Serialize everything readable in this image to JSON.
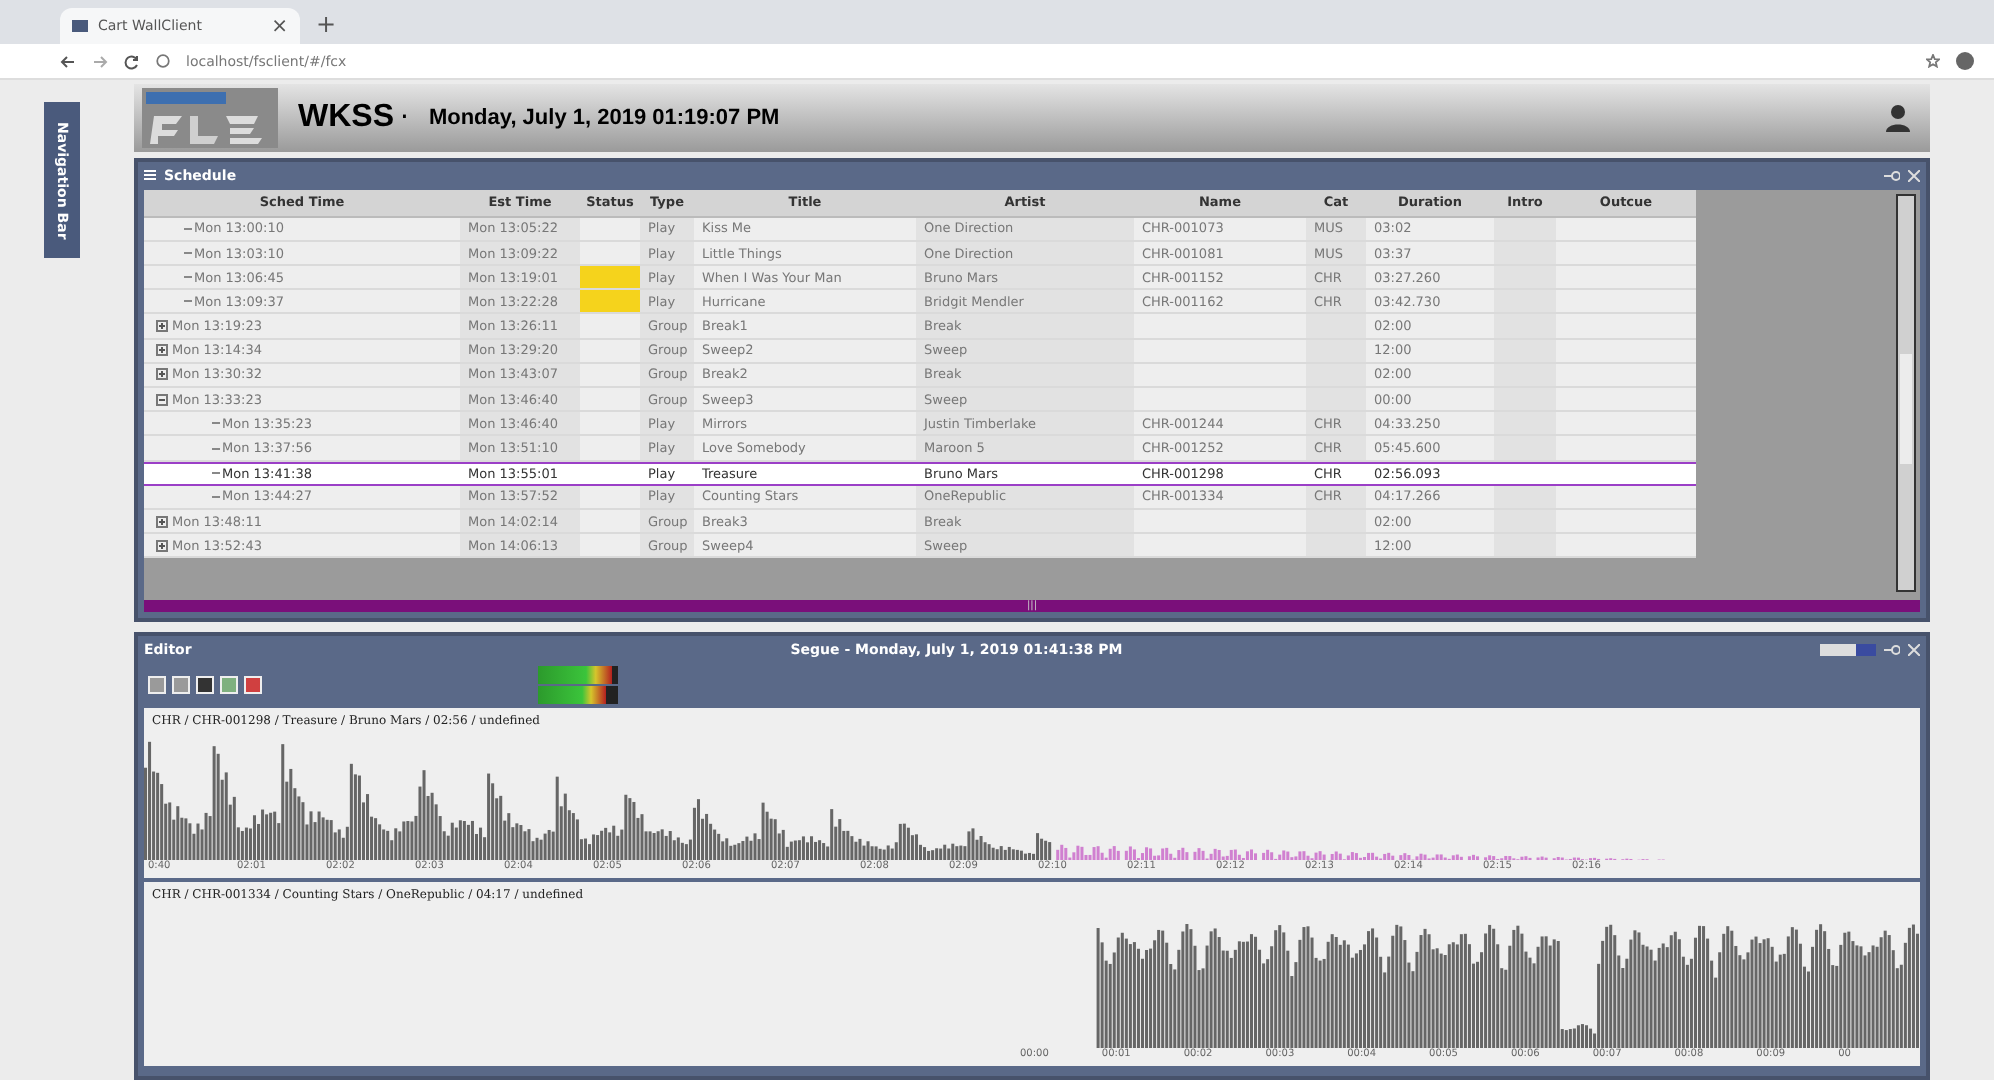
{
  "browser": {
    "tab_title": "Cart WallClient",
    "close": "×",
    "new_tab": "+",
    "url": "localhost/fsclient/#/fcx"
  },
  "nav_bar": {
    "label": "Navigation Bar"
  },
  "header": {
    "station": "WKSS",
    "separator": "·",
    "datetime": "Monday, July 1, 2019 01:19:07 PM"
  },
  "schedule": {
    "title": "Schedule",
    "columns": [
      "Sched Time",
      "Est Time",
      "Status",
      "Type",
      "Title",
      "Artist",
      "Name",
      "Cat",
      "Duration",
      "Intro",
      "Outcue"
    ],
    "rows": [
      {
        "kind": "play",
        "selected": false,
        "sched": "Mon 13:00:10",
        "est": "Mon 13:05:22",
        "type": "Play",
        "title": "Kiss Me",
        "artist": "One Direction",
        "name": "CHR-001073",
        "cat": "MUS",
        "duration": "03:02"
      },
      {
        "kind": "play",
        "selected": false,
        "sched": "Mon 13:03:10",
        "est": "Mon 13:09:22",
        "type": "Play",
        "title": "Little Things",
        "artist": "One Direction",
        "name": "CHR-001081",
        "cat": "MUS",
        "duration": "03:37"
      },
      {
        "kind": "play",
        "selected": false,
        "color": "#f5d31c",
        "sched": "Mon 13:06:45",
        "est": "Mon 13:19:01",
        "type": "Play",
        "title": "When I Was Your Man",
        "artist": "Bruno Mars",
        "name": "CHR-001152",
        "cat": "CHR",
        "duration": "03:27.260"
      },
      {
        "kind": "play",
        "selected": false,
        "color": "#f5d31c",
        "sched": "Mon 13:09:37",
        "est": "Mon 13:22:28",
        "type": "Play",
        "title": "Hurricane",
        "artist": "Bridgit Mendler",
        "name": "CHR-001162",
        "cat": "CHR",
        "duration": "03:42.730"
      },
      {
        "kind": "group",
        "selected": false,
        "expanded": false,
        "sched": "Mon 13:19:23",
        "est": "Mon 13:26:11",
        "type": "Group",
        "title": "Break1",
        "artist": "Break",
        "duration": "02:00"
      },
      {
        "kind": "group",
        "selected": false,
        "expanded": false,
        "sched": "Mon 13:14:34",
        "est": "Mon 13:29:20",
        "type": "Group",
        "title": "Sweep2",
        "artist": "Sweep",
        "duration": "12:00"
      },
      {
        "kind": "group",
        "selected": false,
        "expanded": false,
        "sched": "Mon 13:30:32",
        "est": "Mon 13:43:07",
        "type": "Group",
        "title": "Break2",
        "artist": "Break",
        "duration": "02:00"
      },
      {
        "kind": "group",
        "selected": false,
        "expanded": true,
        "sched": "Mon 13:33:23",
        "est": "Mon 13:46:40",
        "type": "Group",
        "title": "Sweep3",
        "artist": "Sweep",
        "duration": "00:00",
        "children": [
          {
            "kind": "play",
            "selected": false,
            "sched": "Mon 13:35:23",
            "est": "Mon 13:46:40",
            "type": "Play",
            "title": "Mirrors",
            "artist": "Justin Timberlake",
            "name": "CHR-001244",
            "cat": "CHR",
            "duration": "04:33.250"
          },
          {
            "kind": "play",
            "selected": false,
            "sched": "Mon 13:37:56",
            "est": "Mon 13:51:10",
            "type": "Play",
            "title": "Love Somebody",
            "artist": "Maroon 5",
            "name": "CHR-001252",
            "cat": "CHR",
            "duration": "05:45.600"
          },
          {
            "kind": "play",
            "selected": true,
            "sched": "Mon 13:41:38",
            "est": "Mon 13:55:01",
            "type": "Play",
            "title": "Treasure",
            "artist": "Bruno Mars",
            "name": "CHR-001298",
            "cat": "CHR",
            "duration": "02:56.093"
          },
          {
            "kind": "play",
            "selected": false,
            "sched": "Mon 13:44:27",
            "est": "Mon 13:57:52",
            "type": "Play",
            "title": "Counting Stars",
            "artist": "OneRepublic",
            "name": "CHR-001334",
            "cat": "CHR",
            "duration": "04:17.266"
          }
        ]
      },
      {
        "kind": "group",
        "selected": false,
        "expanded": false,
        "sched": "Mon 13:48:11",
        "est": "Mon 14:02:14",
        "type": "Group",
        "title": "Break3",
        "artist": "Break",
        "duration": "02:00"
      },
      {
        "kind": "group",
        "selected": false,
        "expanded": false,
        "sched": "Mon 13:52:43",
        "est": "Mon 14:06:13",
        "type": "Group",
        "title": "Sweep4",
        "artist": "Sweep",
        "duration": "12:00"
      }
    ],
    "scroll_handle": "|||"
  },
  "editor": {
    "title": "Editor",
    "segue": "Segue - Monday, July 1, 2019 01:41:38 PM",
    "meters": [
      {
        "level": 0.92
      },
      {
        "level": 0.86
      }
    ],
    "tracks": [
      {
        "kind": "outgoing",
        "label": "CHR / CHR-001298 / Treasure / Bruno Mars / 02:56 / undefined",
        "ticks": [
          "0:40",
          "02:01",
          "02:02",
          "02:03",
          "02:04",
          "02:05",
          "02:06",
          "02:07",
          "02:08",
          "02:09",
          "02:10",
          "02:11",
          "02:12",
          "02:13",
          "02:14",
          "02:15",
          "02:16"
        ]
      },
      {
        "kind": "incoming",
        "label": "CHR / CHR-001334 / Counting Stars / OneRepublic / 04:17 / undefined",
        "ticks": [
          "00:00",
          "00:01",
          "00:02",
          "00:03",
          "00:04",
          "00:05",
          "00:06",
          "00:07",
          "00:08",
          "00:09",
          "00"
        ]
      }
    ]
  }
}
